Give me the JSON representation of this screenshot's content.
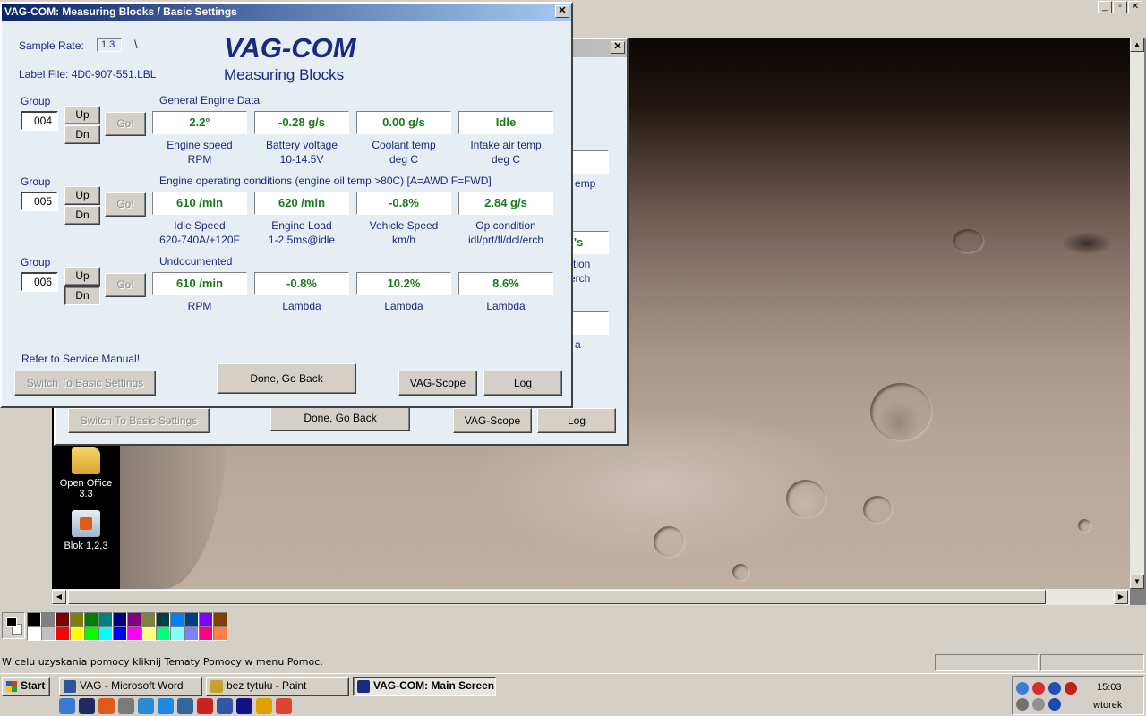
{
  "front_window": {
    "title": "VAG-COM: Measuring Blocks / Basic Settings",
    "close_glyph": "✕",
    "brand_title": "VAG-COM",
    "brand_subtitle": "Measuring Blocks",
    "sample_rate_label": "Sample Rate:",
    "sample_rate_value": "1.3",
    "sample_rate_spinner": "\\",
    "label_file": "Label File:  4D0-907-551.LBL",
    "groups": [
      {
        "group_label": "Group",
        "number": "004",
        "up": "Up",
        "dn": "Dn",
        "go": "Go!",
        "heading": "General Engine Data",
        "values": [
          "2.2°",
          "-0.28 g/s",
          "0.00 g/s",
          "Idle"
        ],
        "labels": [
          [
            "Engine speed",
            "RPM"
          ],
          [
            "Battery voltage",
            "10-14.5V"
          ],
          [
            "Coolant temp",
            "deg C"
          ],
          [
            "Intake air temp",
            "deg C"
          ]
        ]
      },
      {
        "group_label": "Group",
        "number": "005",
        "up": "Up",
        "dn": "Dn",
        "go": "Go!",
        "heading": "Engine operating conditions (engine oil temp >80C) [A=AWD F=FWD]",
        "values": [
          "610 /min",
          "620 /min",
          "-0.8%",
          "2.84 g/s"
        ],
        "labels": [
          [
            "Idle Speed",
            "620-740A/+120F"
          ],
          [
            "Engine Load",
            "1-2.5ms@idle"
          ],
          [
            "Vehicle Speed",
            "km/h"
          ],
          [
            "Op condition",
            "idl/prt/fl/dcl/erch"
          ]
        ]
      },
      {
        "group_label": "Group",
        "number": "006",
        "up": "Up",
        "dn": "Dn",
        "go": "Go!",
        "heading": "Undocumented",
        "values": [
          "610 /min",
          "-0.8%",
          "10.2%",
          "8.6%"
        ],
        "labels": [
          [
            "RPM",
            ""
          ],
          [
            "Lambda",
            ""
          ],
          [
            "Lambda",
            ""
          ],
          [
            "Lambda",
            ""
          ]
        ]
      }
    ],
    "refer_text": "Refer to Service Manual!",
    "switch_button": "Switch To Basic Settings",
    "done_button": "Done, Go Back",
    "vagscope_button": "VAG-Scope",
    "log_button": "Log"
  },
  "back_window": {
    "close_glyph": "✕",
    "partial_texts": [
      "emp",
      "'s",
      "tion",
      "erch",
      "a"
    ],
    "switch_button": "Switch To Basic Settings",
    "done_button": "Done, Go Back",
    "vagscope_button": "VAG-Scope",
    "log_button": "Log"
  },
  "paint": {
    "mdi_buttons": [
      "_",
      "▫",
      "✕"
    ],
    "status_text": "W celu uzyskania pomocy kliknij Tematy Pomocy w menu Pomoc.",
    "scroll_up": "▲",
    "scroll_down": "▼",
    "scroll_left": "◀",
    "scroll_right": "▶",
    "palette_top": [
      "#000000",
      "#808080",
      "#800000",
      "#808000",
      "#008000",
      "#008080",
      "#000080",
      "#800080",
      "#808040",
      "#004040",
      "#0080ff",
      "#004080",
      "#8000ff",
      "#804000"
    ],
    "palette_bottom": [
      "#ffffff",
      "#c0c0c0",
      "#ff0000",
      "#ffff00",
      "#00ff00",
      "#00ffff",
      "#0000ff",
      "#ff00ff",
      "#ffff80",
      "#00ff80",
      "#80ffff",
      "#8080ff",
      "#ff0080",
      "#ff8040"
    ]
  },
  "desktop_icons": [
    {
      "label_line1": "Open Office",
      "label_line2": "3.3",
      "icon": "folder-icon"
    },
    {
      "label_line1": "Blok 1,2,3",
      "label_line2": "",
      "icon": "paint-file-icon"
    }
  ],
  "taskbar": {
    "start_label": "Start",
    "tasks": [
      {
        "label": "VAG - Microsoft Word",
        "icon": "word-icon",
        "color": "#2b579a"
      },
      {
        "label": "bez tytułu - Paint",
        "icon": "paint-icon",
        "color": "#c8a030"
      },
      {
        "label": "VAG-COM: Main Screen",
        "icon": "vagcom-icon",
        "color": "#1a2a80"
      }
    ],
    "quicklaunch_colors": [
      "#3a7bd5",
      "#202a60",
      "#e05a1a",
      "#7a7a7a",
      "#2a8ad0",
      "#1e88e5",
      "#336699",
      "#cc2222",
      "#3355aa",
      "#111188",
      "#e0a000",
      "#dd4433"
    ],
    "clock": "15:03",
    "day": "wtorek"
  }
}
